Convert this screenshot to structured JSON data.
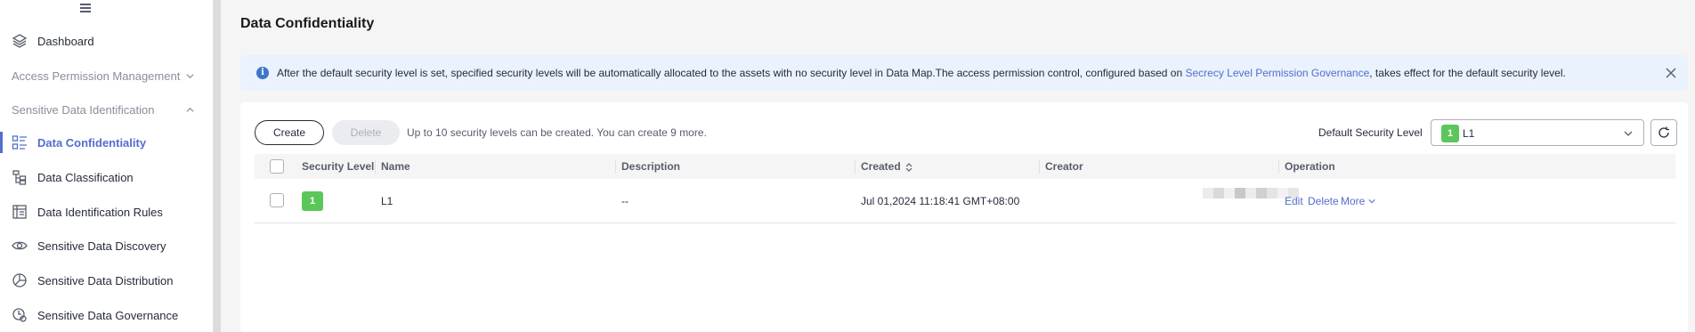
{
  "sidebar": {
    "items": [
      {
        "label": "Dashboard"
      },
      {
        "label": "Access Permission Management"
      },
      {
        "label": "Sensitive Data Identification"
      },
      {
        "label": "Data Confidentiality"
      },
      {
        "label": "Data Classification"
      },
      {
        "label": "Data Identification Rules"
      },
      {
        "label": "Sensitive Data Discovery"
      },
      {
        "label": "Sensitive Data Distribution"
      },
      {
        "label": "Sensitive Data Governance"
      }
    ]
  },
  "page": {
    "title": "Data Confidentiality"
  },
  "alert": {
    "text_before": "After the default security level is set, specified security levels will be automatically allocated to the assets with no security level in Data Map.The access permission control, configured based on ",
    "link": "Secrecy Level Permission Governance",
    "text_after": ", takes effect for the default security level."
  },
  "toolbar": {
    "create_label": "Create",
    "delete_label": "Delete",
    "hint": "Up to 10 security levels can be created. You can create 9 more.",
    "default_level_label": "Default Security Level",
    "default_level_badge": "1",
    "default_level_value": "L1"
  },
  "table": {
    "columns": [
      "Security Level",
      "Name",
      "Description",
      "Created",
      "Creator",
      "Operation"
    ],
    "rows": [
      {
        "level": "1",
        "name": "L1",
        "description": "--",
        "created": "Jul 01,2024 11:18:41 GMT+08:00",
        "operations": {
          "edit": "Edit",
          "delete": "Delete",
          "more": "More"
        }
      }
    ]
  },
  "colors": {
    "accent": "#526ecc",
    "level_green": "#5bc75a",
    "alert_bg": "#eaf2fd"
  }
}
